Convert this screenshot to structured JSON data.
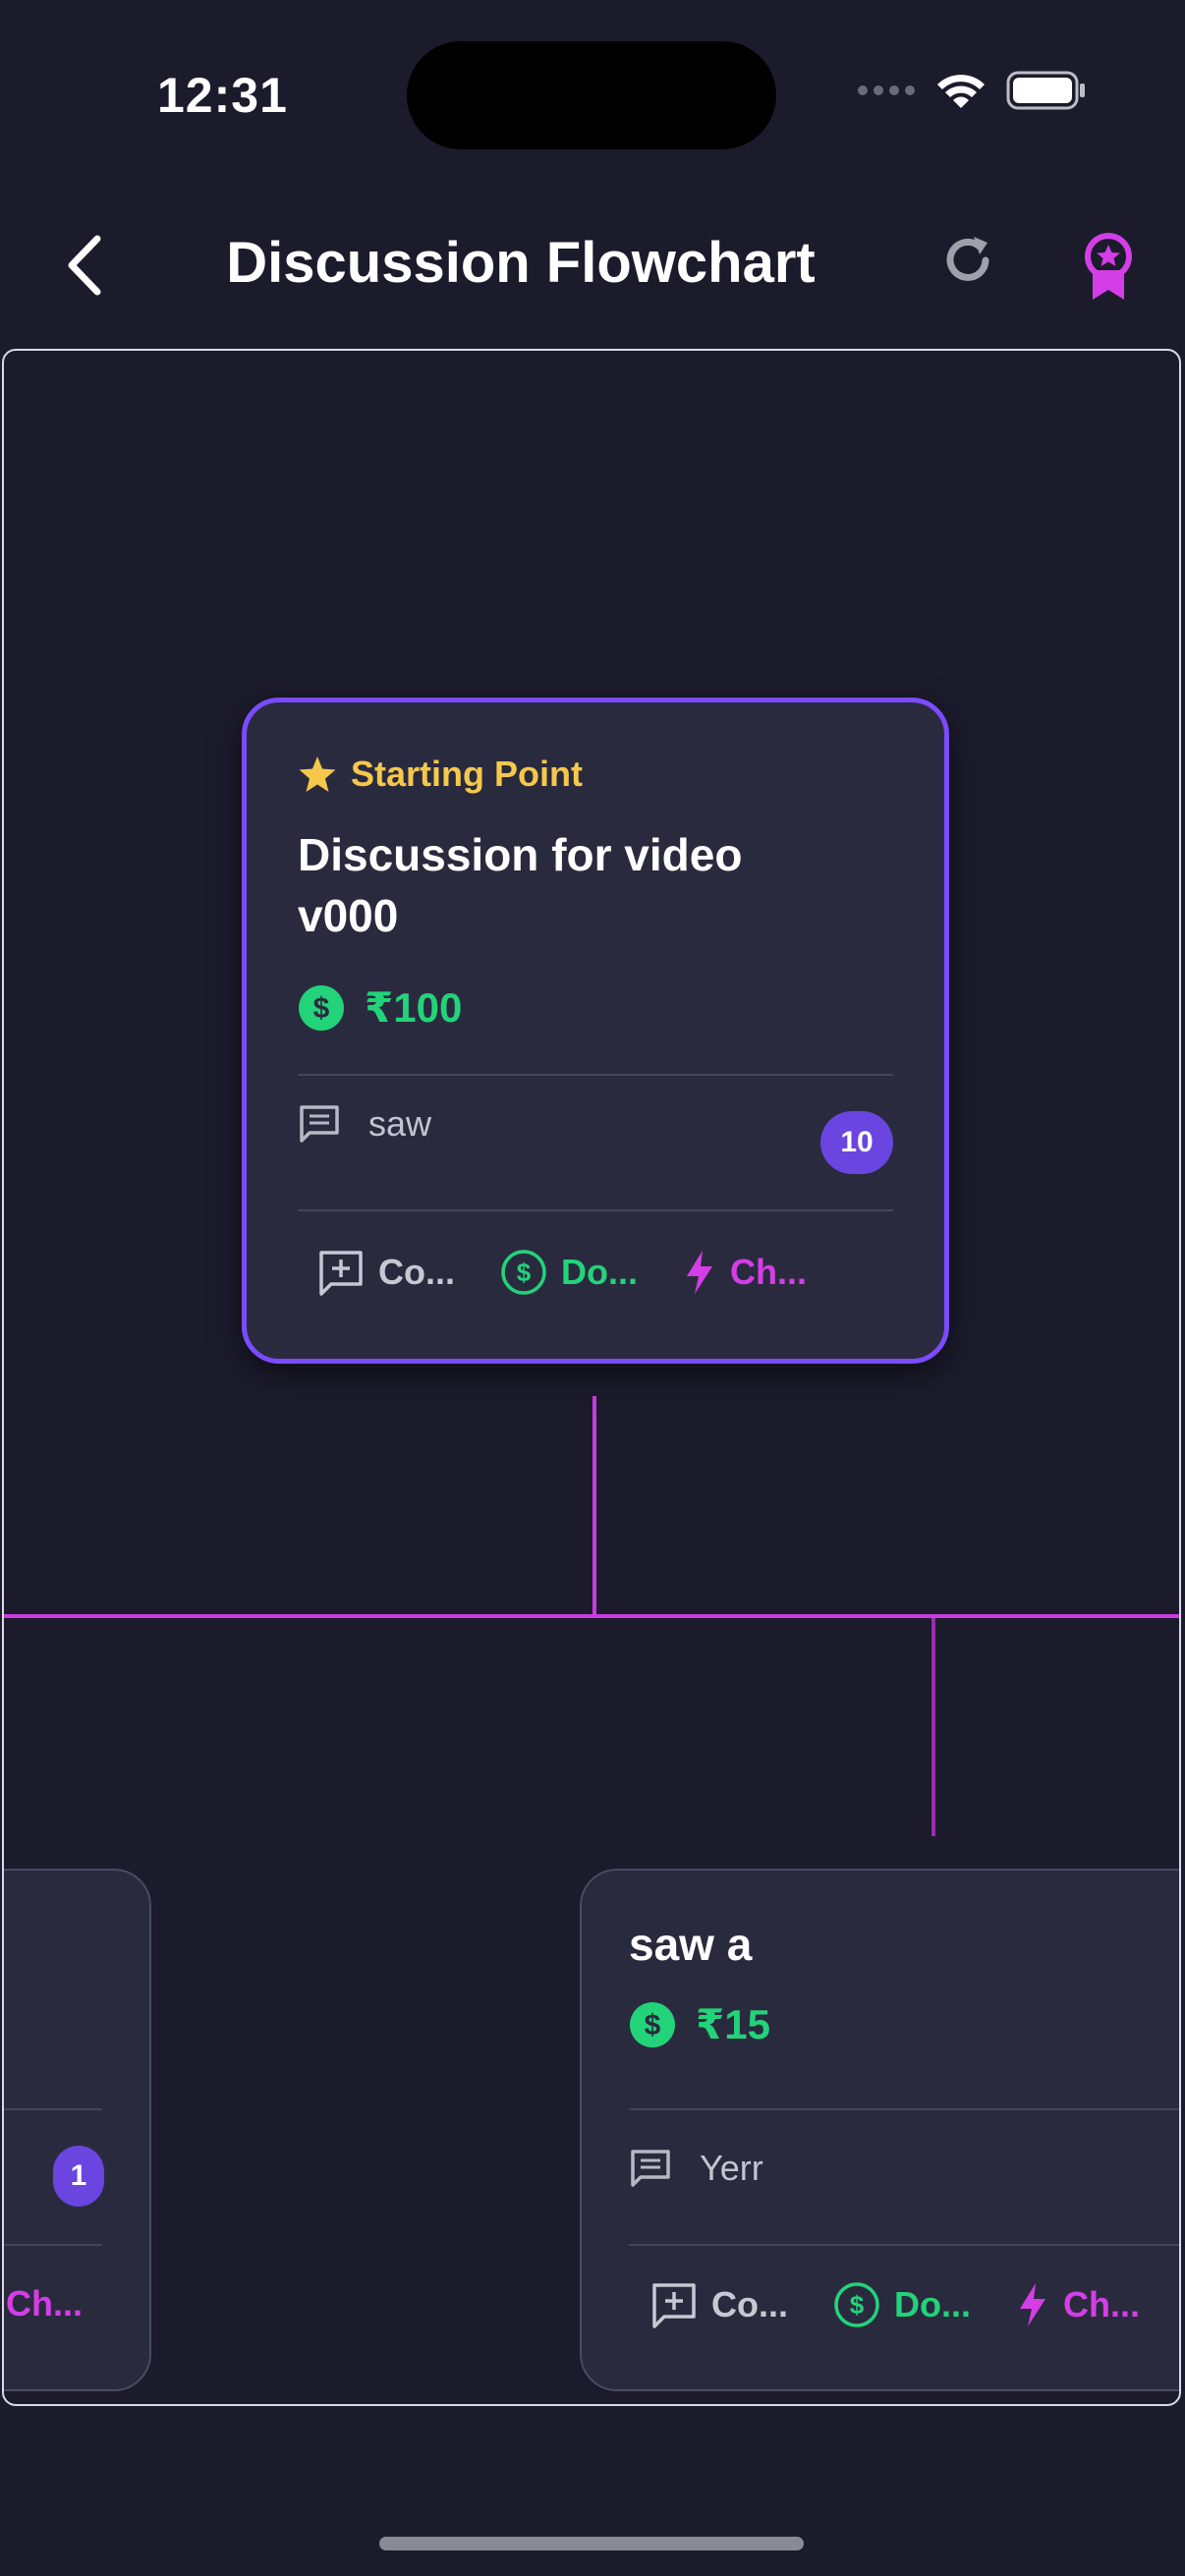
{
  "status_bar": {
    "time": "12:31"
  },
  "header": {
    "title": "Discussion Flowchart"
  },
  "main_card": {
    "tag": "Starting Point",
    "title": "Discussion for video v000",
    "amount": "₹100",
    "comment": "saw",
    "count": "10",
    "actions": {
      "comment": "Co...",
      "donate": "Do...",
      "challenge": "Ch..."
    }
  },
  "left_card": {
    "count": "1",
    "actions": {
      "challenge": "Ch..."
    }
  },
  "right_card": {
    "title": "saw a",
    "amount": "₹15",
    "comment": "Yerr",
    "actions": {
      "comment": "Co...",
      "donate": "Do...",
      "challenge": "Ch..."
    }
  },
  "colors": {
    "background": "#1b1b2c",
    "card": "#2a2a3e",
    "accent_purple": "#7a4bff",
    "connector": "#c93be0",
    "money_green": "#22d37a",
    "star_yellow": "#f5c84c",
    "challenge_pink": "#d43ee6"
  }
}
